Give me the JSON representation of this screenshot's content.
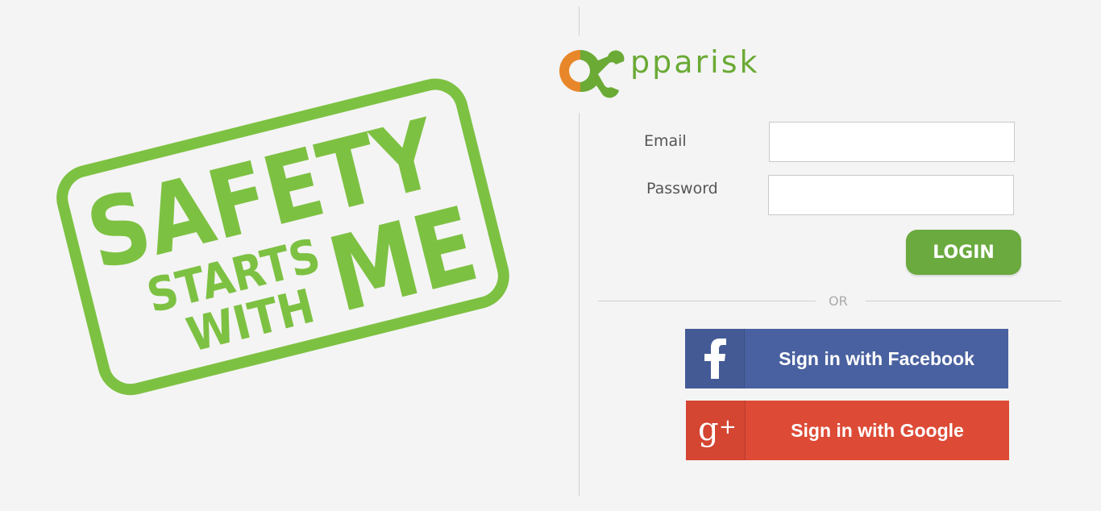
{
  "stamp": {
    "line1": "SAFETY",
    "line2": "STARTS",
    "line3": "WITH",
    "line4": "ME",
    "color": "#7dc142"
  },
  "logo": {
    "text": "pparisk",
    "orange": "#e8872a",
    "green": "#6aaa35"
  },
  "form": {
    "email_label": "Email",
    "email_value": "",
    "password_label": "Password",
    "password_value": "",
    "login_label": "LOGIN"
  },
  "separator": {
    "or_label": "OR"
  },
  "social": {
    "facebook_label": "Sign in with Facebook",
    "facebook_icon": "facebook-icon",
    "facebook_color": "#4961a0",
    "google_label": "Sign in with Google",
    "google_icon": "google-plus-icon",
    "google_color": "#dd4b36"
  }
}
